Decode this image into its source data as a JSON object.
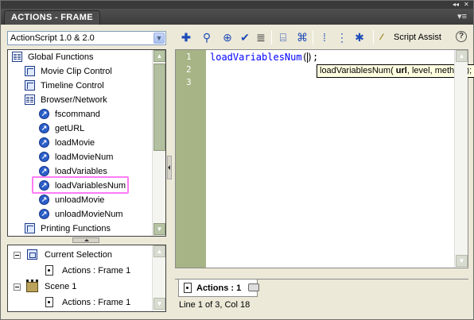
{
  "window": {
    "title": "ACTIONS - FRAME",
    "collapse_glyph": "◂◂",
    "close_glyph": "✕",
    "menu_glyph": "▾≡"
  },
  "toolbox": {
    "language_selected": "ActionScript 1.0 & 2.0",
    "items": [
      {
        "label": "Global Functions",
        "icon": "book-open-icon",
        "indent": 0
      },
      {
        "label": "Movie Clip Control",
        "icon": "book-icon",
        "indent": 1
      },
      {
        "label": "Timeline Control",
        "icon": "book-icon",
        "indent": 1
      },
      {
        "label": "Browser/Network",
        "icon": "book-open-icon",
        "indent": 1
      },
      {
        "label": "fscommand",
        "icon": "function-icon",
        "indent": 2
      },
      {
        "label": "getURL",
        "icon": "function-icon",
        "indent": 2
      },
      {
        "label": "loadMovie",
        "icon": "function-icon",
        "indent": 2
      },
      {
        "label": "loadMovieNum",
        "icon": "function-icon",
        "indent": 2
      },
      {
        "label": "loadVariables",
        "icon": "function-icon",
        "indent": 2
      },
      {
        "label": "loadVariablesNum",
        "icon": "function-icon",
        "indent": 2,
        "highlighted": true
      },
      {
        "label": "unloadMovie",
        "icon": "function-icon",
        "indent": 2
      },
      {
        "label": "unloadMovieNum",
        "icon": "function-icon",
        "indent": 2
      },
      {
        "label": "Printing Functions",
        "icon": "book-icon",
        "indent": 1
      }
    ]
  },
  "script_navigator": {
    "current_selection": "Current Selection",
    "current_action": "Actions : Frame 1",
    "scene": "Scene 1",
    "scene_action": "Actions : Frame 1"
  },
  "toolbar": {
    "tools": [
      "add-item-icon",
      "find-icon",
      "target-path-icon",
      "check-syntax-icon",
      "auto-format-icon",
      "code-hint-icon",
      "debug-options-icon",
      "collapse-braces-icon",
      "collapse-selection-icon",
      "expand-all-icon"
    ],
    "script_assist_label": "Script Assist",
    "help_label": "?"
  },
  "editor": {
    "line_numbers": [
      "1",
      "2",
      "3"
    ],
    "code_function": "loadVariablesNum",
    "code_open": "(",
    "code_close": ");",
    "tooltip_prefix": "loadVariablesNum( ",
    "tooltip_bold": "url",
    "tooltip_suffix": ", level, method );"
  },
  "script_tab": {
    "label": "Actions : 1"
  },
  "status": "Line 1 of 3, Col 18",
  "colors": {
    "gutter": "#a7b485",
    "keyword": "#0000ff",
    "highlight_box": "#ff7cf6",
    "titlebar": "#4c4c4c"
  }
}
